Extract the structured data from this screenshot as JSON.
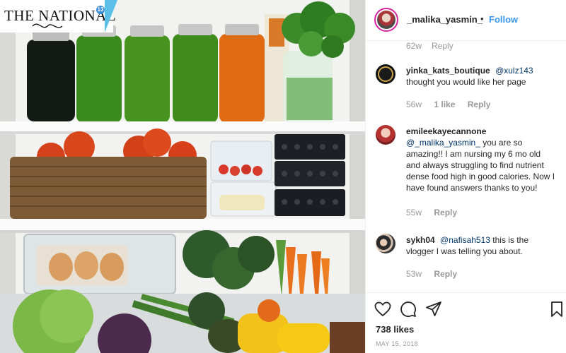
{
  "post": {
    "brand_logo_text": "THE NATIONAL",
    "brand_logo_badge": "13"
  },
  "header": {
    "username": "_malika_yasmin_",
    "separator": "•",
    "follow_label": "Follow"
  },
  "cut_off_comment": {
    "time": "62w",
    "reply": "Reply"
  },
  "comments": [
    {
      "username": "yinka_kats_boutique",
      "mention": "@xulz143",
      "text": "thought you would like her page",
      "time": "56w",
      "likes": "1 like",
      "reply": "Reply"
    },
    {
      "username": "emileekayecannone",
      "mention": "@_malika_yasmin_",
      "text": "you are so amazing!! I am nursing my 6 mo old and always struggling to find nutrient dense food high in good calories. Now I have found answers thanks to you!",
      "time": "55w",
      "reply": "Reply"
    },
    {
      "username": "sykh04",
      "mention": "@nafisah513",
      "text": "this is the vlogger I was telling you about.",
      "time": "53w",
      "reply": "Reply"
    }
  ],
  "footer": {
    "likes": "738 likes",
    "date": "MAY 15, 2018"
  },
  "icons": {
    "like": "heart-icon",
    "comment": "comment-bubble-icon",
    "share": "paper-plane-icon",
    "save": "bookmark-icon"
  }
}
